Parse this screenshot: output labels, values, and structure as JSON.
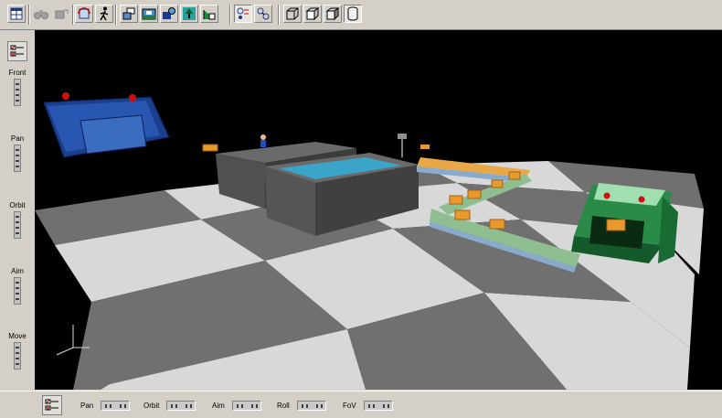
{
  "toolbar": {
    "icons": [
      "layout-icon",
      "binoculars-icon",
      "camera-link-icon",
      "rotate-view-icon",
      "walk-icon",
      "camera-front-icon",
      "camera-landscape-icon",
      "camera-move-icon",
      "camera-tree-icon",
      "camera-grid-icon",
      "snap-to-icon",
      "rotate-to-icon",
      "box-wire-icon",
      "box-solid-icon",
      "box-shaded-icon",
      "cylinder-icon"
    ]
  },
  "leftbar": {
    "labels": {
      "front": "Front",
      "pan": "Pan",
      "orbit": "Orbit",
      "aim": "Aim",
      "move": "Move"
    }
  },
  "bottombar": {
    "pan": "Pan",
    "orbit": "Orbit",
    "aim": "Aim",
    "roll": "Roll",
    "fov": "FoV"
  },
  "colors": {
    "chrome": "#d4d0c8",
    "viewport_bg": "#000000",
    "floor_light": "#d8d8d8",
    "floor_dark": "#707070",
    "tank": "#555555",
    "water": "#3aa5c8",
    "conveyor_green": "#8fbf90",
    "conveyor_blue": "#8aaacc",
    "box_orange": "#e89a2c",
    "machine_green": "#1f7a3a",
    "machine_blue": "#1e4fa8",
    "indicator_red": "#d01010"
  }
}
